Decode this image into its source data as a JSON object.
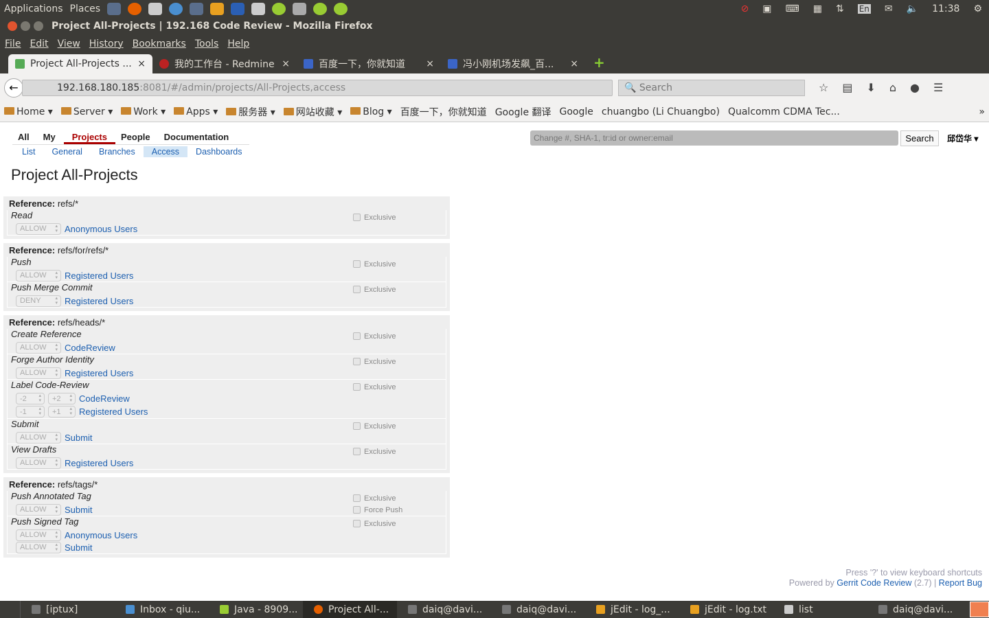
{
  "system_panel": {
    "applications": "Applications",
    "places": "Places",
    "keyboard": "En",
    "clock": "11:38"
  },
  "window": {
    "title": "Project All-Projects | 192.168 Code Review - Mozilla Firefox"
  },
  "menu": [
    "File",
    "Edit",
    "View",
    "History",
    "Bookmarks",
    "Tools",
    "Help"
  ],
  "tabs": [
    {
      "label": "Project All-Projects ..."
    },
    {
      "label": "我的工作台 - Redmine"
    },
    {
      "label": "百度一下，你就知道"
    },
    {
      "label": "冯小刚机场发飙_百..."
    }
  ],
  "nav": {
    "url_host": "192.168.180.185",
    "url_rest": ":8081/#/admin/projects/All-Projects,access",
    "search_placeholder": "Search"
  },
  "bookmarks": [
    "Home ▾",
    "Server ▾",
    "Work ▾",
    "Apps ▾",
    "服务器 ▾",
    "网站收藏 ▾",
    "Blog ▾",
    "百度一下，你就知道",
    "Google 翻译",
    "Google",
    "chuangbo (Li Chuangbo)",
    "Qualcomm CDMA Tec..."
  ],
  "gerrit": {
    "top_menu": [
      "All",
      "My",
      "Projects",
      "People",
      "Documentation"
    ],
    "sub_menu": [
      "List",
      "General",
      "Branches",
      "Access",
      "Dashboards"
    ],
    "search_placeholder": "Change #, SHA-1, tr:id or owner:email",
    "search_button": "Search",
    "user": "邱岱华 ▾",
    "page_title": "Project All-Projects",
    "reference_label": "Reference:",
    "sections": [
      {
        "ref": "refs/*",
        "permissions": [
          {
            "name": "Read",
            "options": [
              "Exclusive"
            ],
            "rules": [
              {
                "action": "ALLOW",
                "group": "Anonymous Users"
              }
            ]
          }
        ]
      },
      {
        "ref": "refs/for/refs/*",
        "permissions": [
          {
            "name": "Push",
            "options": [
              "Exclusive"
            ],
            "rules": [
              {
                "action": "ALLOW",
                "group": "Registered Users"
              }
            ]
          },
          {
            "name": "Push Merge Commit",
            "options": [
              "Exclusive"
            ],
            "rules": [
              {
                "action": "DENY",
                "group": "Registered Users"
              }
            ]
          }
        ]
      },
      {
        "ref": "refs/heads/*",
        "permissions": [
          {
            "name": "Create Reference",
            "options": [
              "Exclusive"
            ],
            "rules": [
              {
                "action": "ALLOW",
                "group": "CodeReview"
              }
            ]
          },
          {
            "name": "Forge Author Identity",
            "options": [
              "Exclusive"
            ],
            "rules": [
              {
                "action": "ALLOW",
                "group": "Registered Users"
              }
            ]
          },
          {
            "name": "Label Code-Review",
            "options": [
              "Exclusive"
            ],
            "rules": [
              {
                "min": "-2",
                "max": "+2",
                "group": "CodeReview"
              },
              {
                "min": "-1",
                "max": "+1",
                "group": "Registered Users"
              }
            ]
          },
          {
            "name": "Submit",
            "options": [
              "Exclusive"
            ],
            "rules": [
              {
                "action": "ALLOW",
                "group": "Submit"
              }
            ]
          },
          {
            "name": "View Drafts",
            "options": [
              "Exclusive"
            ],
            "rules": [
              {
                "action": "ALLOW",
                "group": "Registered Users"
              }
            ]
          }
        ]
      },
      {
        "ref": "refs/tags/*",
        "permissions": [
          {
            "name": "Push Annotated Tag",
            "options": [
              "Exclusive",
              "Force Push"
            ],
            "rules": [
              {
                "action": "ALLOW",
                "group": "Submit"
              }
            ]
          },
          {
            "name": "Push Signed Tag",
            "options": [
              "Exclusive"
            ],
            "rules": [
              {
                "action": "ALLOW",
                "group": "Anonymous Users"
              },
              {
                "action": "ALLOW",
                "group": "Submit"
              }
            ]
          }
        ]
      }
    ],
    "footer": {
      "shortcuts": "Press '?' to view keyboard shortcuts",
      "powered_by": "Powered by",
      "gerrit_link": "Gerrit Code Review",
      "version": "(2.7)",
      "separator": "|",
      "report_bug": "Report Bug"
    }
  },
  "taskbar": [
    "[iptux]",
    "Inbox - qiu...",
    "Java - 8909...",
    "Project All-...",
    "daiq@davi...",
    "daiq@davi...",
    "jEdit - log_...",
    "jEdit - log.txt",
    "list",
    "daiq@davi..."
  ]
}
